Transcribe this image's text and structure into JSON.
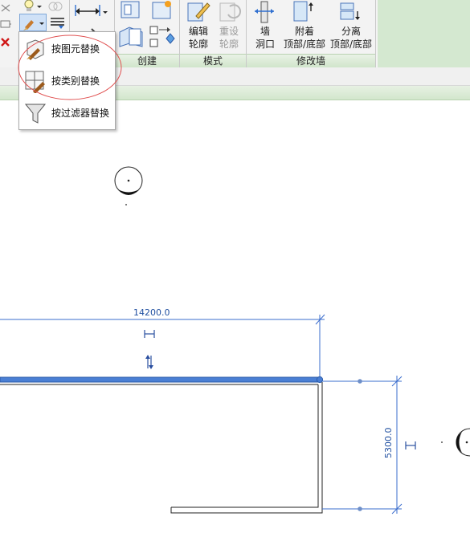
{
  "ribbon": {
    "panels": {
      "create": "创建",
      "mode": "模式",
      "modify_wall": "修改墙"
    },
    "buttons": {
      "edit_profile": [
        "编辑",
        "轮廓"
      ],
      "reset_profile": [
        "重设",
        "轮廓"
      ],
      "wall_opening": [
        "墙",
        "洞口"
      ],
      "attach_top_base": [
        "附着",
        "顶部/底部"
      ],
      "detach_top_base": [
        "分离",
        "顶部/底部"
      ]
    }
  },
  "override_menu": {
    "items": [
      {
        "label": "按图元替换",
        "icon": "brush-element-icon"
      },
      {
        "label": "按类别替换",
        "icon": "category-cubes-icon"
      },
      {
        "label": "按过滤器替换",
        "icon": "funnel-filter-icon"
      }
    ],
    "highlight_color": "#e05050"
  },
  "drawing": {
    "dimension_horizontal": "14200.0",
    "dimension_vertical": "5300.0",
    "wall_selected_color": "#4a7fd4",
    "dimension_color": "#3a6ccc"
  }
}
